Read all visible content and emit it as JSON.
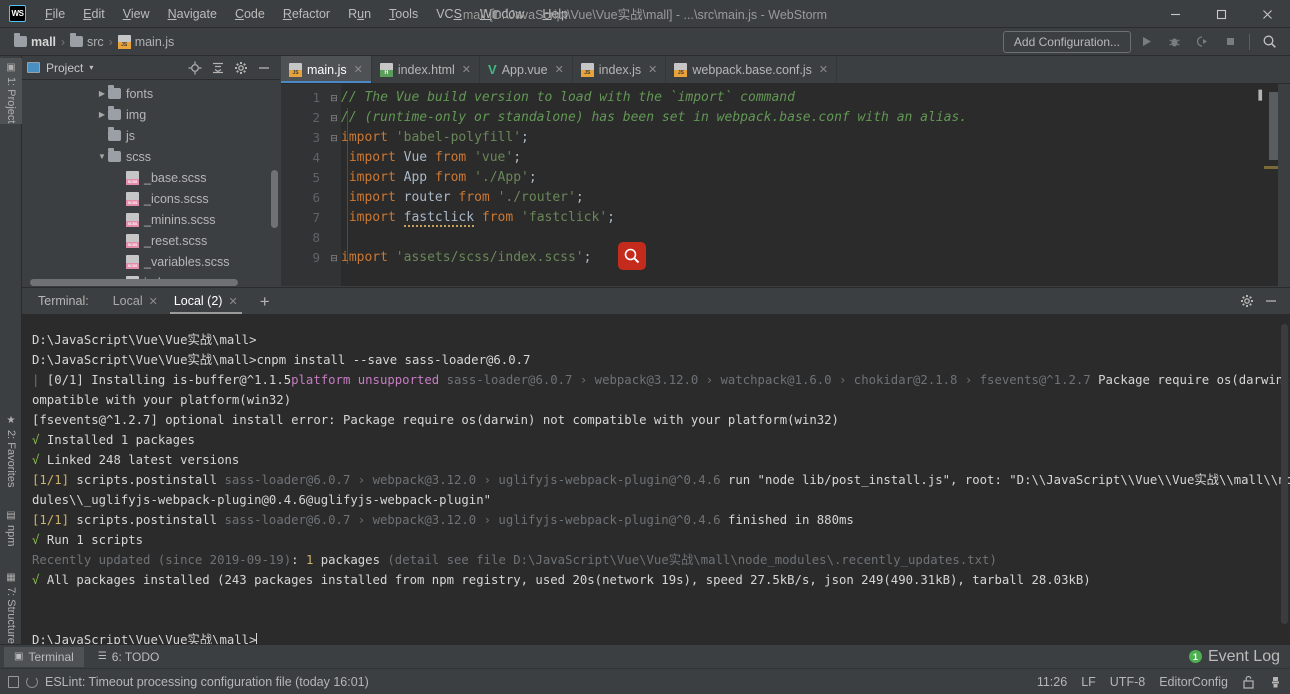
{
  "window": {
    "title": "mall [D:\\JavaScript\\Vue\\Vue实战\\mall] - ...\\src\\main.js - WebStorm",
    "logo": "WS",
    "minimize": "—",
    "maximize": "▢",
    "close": "✕"
  },
  "menubar": {
    "items": [
      "File",
      "Edit",
      "View",
      "Navigate",
      "Code",
      "Refactor",
      "Run",
      "Tools",
      "VCS",
      "Window",
      "Help"
    ]
  },
  "breadcrumb": {
    "items": [
      {
        "label": "mall",
        "icon": "folder-icon"
      },
      {
        "label": "src",
        "icon": "folder-icon"
      },
      {
        "label": "main.js",
        "icon": "js-file-icon"
      }
    ],
    "separator": "›"
  },
  "navbar_right": {
    "add_configuration": "Add Configuration...",
    "icons": [
      "run-icon",
      "debug-icon",
      "run-coverage-icon",
      "stop-icon",
      "search-everywhere-icon"
    ]
  },
  "left_tool_strip": {
    "tabs": [
      {
        "label": "1: Project",
        "icon": "project-icon",
        "active": true
      },
      {
        "label": "2: Favorites",
        "icon": "star-icon",
        "active": false
      },
      {
        "label": "npm",
        "icon": "npm-icon",
        "active": false
      },
      {
        "label": "7: Structure",
        "icon": "structure-icon",
        "active": false
      }
    ]
  },
  "project_panel": {
    "title": "Project",
    "chevron": "▾",
    "tools": [
      "locate-icon",
      "collapse-all-icon",
      "settings-icon",
      "hide-icon"
    ],
    "tree": [
      {
        "label": "fonts",
        "icon": "folder-icon",
        "arrow": "▶",
        "indent": 3,
        "type": "folder"
      },
      {
        "label": "img",
        "icon": "folder-icon",
        "arrow": "▶",
        "indent": 3,
        "type": "folder"
      },
      {
        "label": "js",
        "icon": "folder-icon",
        "arrow": "",
        "indent": 3,
        "type": "folder"
      },
      {
        "label": "scss",
        "icon": "folder-icon",
        "arrow": "▼",
        "indent": 3,
        "type": "folder"
      },
      {
        "label": "_base.scss",
        "icon": "scss-file-icon",
        "arrow": "",
        "indent": 4,
        "type": "file"
      },
      {
        "label": "_icons.scss",
        "icon": "scss-file-icon",
        "arrow": "",
        "indent": 4,
        "type": "file"
      },
      {
        "label": "_minins.scss",
        "icon": "scss-file-icon",
        "arrow": "",
        "indent": 4,
        "type": "file"
      },
      {
        "label": "_reset.scss",
        "icon": "scss-file-icon",
        "arrow": "",
        "indent": 4,
        "type": "file"
      },
      {
        "label": "_variables.scss",
        "icon": "scss-file-icon",
        "arrow": "",
        "indent": 4,
        "type": "file"
      },
      {
        "label": "index.scss",
        "icon": "scss-file-icon",
        "arrow": "",
        "indent": 4,
        "type": "file"
      }
    ]
  },
  "editor": {
    "tabs": [
      {
        "label": "main.js",
        "icon": "js-file-icon",
        "active": true,
        "close": "✕"
      },
      {
        "label": "index.html",
        "icon": "html-file-icon",
        "active": false,
        "close": "✕"
      },
      {
        "label": "App.vue",
        "icon": "vue-file-icon",
        "active": false,
        "close": "✕"
      },
      {
        "label": "index.js",
        "icon": "js-file-icon",
        "active": false,
        "close": "✕"
      },
      {
        "label": "webpack.base.conf.js",
        "icon": "js-file-icon",
        "active": false,
        "close": "✕"
      }
    ],
    "line_numbers": [
      "1",
      "2",
      "3",
      "4",
      "5",
      "6",
      "7",
      "8",
      "9"
    ],
    "code_lines": [
      {
        "n": 1,
        "fold": "⊟",
        "text": "// The Vue build version to load with the `import` command",
        "kind": "comment"
      },
      {
        "n": 2,
        "fold": "⊟",
        "text": "// (runtime-only or standalone) has been set in webpack.base.conf with an alias.",
        "kind": "comment"
      },
      {
        "n": 3,
        "fold": "⊟",
        "kw": "import",
        "str": "'babel-polyfill'",
        "tail": ";",
        "kind": "import-str"
      },
      {
        "n": 4,
        "fold": "",
        "kw": "import",
        "id": "Vue",
        "kw2": "from",
        "str": "'vue'",
        "tail": ";",
        "kind": "import-id"
      },
      {
        "n": 5,
        "fold": "",
        "kw": "import",
        "id": "App",
        "kw2": "from",
        "str": "'./App'",
        "tail": ";",
        "kind": "import-id"
      },
      {
        "n": 6,
        "fold": "",
        "kw": "import",
        "id": "router",
        "kw2": "from",
        "str": "'./router'",
        "tail": ";",
        "kind": "import-id"
      },
      {
        "n": 7,
        "fold": "",
        "kw": "import",
        "id": "fastclick",
        "kw2": "from",
        "str": "'fastclick'",
        "tail": ";",
        "kind": "import-warn"
      },
      {
        "n": 8,
        "fold": "",
        "text": "",
        "kind": "blank"
      },
      {
        "n": 9,
        "fold": "⊟",
        "kw": "import",
        "str": "'assets/scss/index.scss'",
        "tail": ";",
        "kind": "import-str"
      }
    ],
    "cursor_overlay_icon": "search-magnifier-icon"
  },
  "terminal": {
    "label": "Terminal:",
    "tabs": [
      {
        "label": "Local",
        "active": false,
        "close": "✕"
      },
      {
        "label": "Local (2)",
        "active": true,
        "close": "✕"
      }
    ],
    "add": "+",
    "header_icons": [
      "settings-icon",
      "hide-icon"
    ],
    "lines": [
      {
        "segs": [
          {
            "t": "D:\\JavaScript\\Vue\\Vue实战\\mall>",
            "c": "t-white"
          }
        ]
      },
      {
        "segs": [
          {
            "t": "D:\\JavaScript\\Vue\\Vue实战\\mall>cnpm install --save sass-loader@6.0.7",
            "c": "t-white"
          }
        ]
      },
      {
        "segs": [
          {
            "t": "| ",
            "c": "t-dim"
          },
          {
            "t": "[0/1] ",
            "c": "t-white"
          },
          {
            "t": "Installing is-buffer@^1.1.5",
            "c": "t-white"
          },
          {
            "t": "platform unsupported",
            "c": "t-magenta"
          },
          {
            "t": " sass-loader@6.0.7 › webpack@3.12.0 › watchpack@1.6.0 › chokidar@2.1.8 › fsevents@^1.2.7 ",
            "c": "t-dim"
          },
          {
            "t": "Package require os(darwin) not c",
            "c": "t-white"
          }
        ]
      },
      {
        "segs": [
          {
            "t": "ompatible with your platform(win32)",
            "c": "t-white"
          }
        ]
      },
      {
        "segs": [
          {
            "t": "[fsevents@^1.2.7] optional install error: Package require os(darwin) not compatible with your platform(win32)",
            "c": "t-white"
          }
        ]
      },
      {
        "segs": [
          {
            "t": "√ ",
            "c": "t-green"
          },
          {
            "t": "Installed 1 packages",
            "c": "t-white"
          }
        ]
      },
      {
        "segs": [
          {
            "t": "√ ",
            "c": "t-green"
          },
          {
            "t": "Linked 248 latest versions",
            "c": "t-white"
          }
        ]
      },
      {
        "segs": [
          {
            "t": "[1/1] ",
            "c": "t-yellow"
          },
          {
            "t": "scripts.postinstall",
            "c": "t-white"
          },
          {
            "t": " sass-loader@6.0.7 › webpack@3.12.0 › uglifyjs-webpack-plugin@^0.4.6 ",
            "c": "t-dim"
          },
          {
            "t": "run \"node lib/post_install.js\", root: \"D:\\\\JavaScript\\\\Vue\\\\Vue实战\\\\mall\\\\node_mo",
            "c": "t-white"
          }
        ]
      },
      {
        "segs": [
          {
            "t": "dules\\\\_uglifyjs-webpack-plugin@0.4.6@uglifyjs-webpack-plugin\"",
            "c": "t-white"
          }
        ]
      },
      {
        "segs": [
          {
            "t": "[1/1] ",
            "c": "t-yellow"
          },
          {
            "t": "scripts.postinstall",
            "c": "t-white"
          },
          {
            "t": " sass-loader@6.0.7 › webpack@3.12.0 › uglifyjs-webpack-plugin@^0.4.6 ",
            "c": "t-dim"
          },
          {
            "t": "finished in 880ms",
            "c": "t-white"
          }
        ]
      },
      {
        "segs": [
          {
            "t": "√ ",
            "c": "t-green"
          },
          {
            "t": "Run 1 scripts",
            "c": "t-white"
          }
        ]
      },
      {
        "segs": [
          {
            "t": "Recently updated (since 2019-09-19)",
            "c": "t-dim"
          },
          {
            "t": ": ",
            "c": "t-white"
          },
          {
            "t": "1",
            "c": "t-yellow"
          },
          {
            "t": " packages ",
            "c": "t-white"
          },
          {
            "t": "(detail see file D:\\JavaScript\\Vue\\Vue实战\\mall\\node_modules\\.recently_updates.txt)",
            "c": "t-dim"
          }
        ]
      },
      {
        "segs": [
          {
            "t": "√ ",
            "c": "t-green"
          },
          {
            "t": "All packages installed (243 packages installed from npm registry, used 20s(network 19s), speed 27.5kB/s, json 249(490.31kB), tarball 28.03kB)",
            "c": "t-white"
          }
        ]
      },
      {
        "segs": [
          {
            "t": "",
            "c": "t-white"
          }
        ]
      },
      {
        "segs": [
          {
            "t": "",
            "c": "t-white"
          }
        ]
      },
      {
        "segs": [
          {
            "t": "D:\\JavaScript\\Vue\\Vue实战\\mall>",
            "c": "t-white"
          }
        ]
      }
    ]
  },
  "bottom_tools": {
    "tabs": [
      {
        "label": "Terminal",
        "icon": "terminal-icon",
        "active": true
      },
      {
        "label": "6: TODO",
        "icon": "todo-icon",
        "active": false
      }
    ],
    "event_log": "Event Log",
    "event_log_count": "1"
  },
  "statusbar": {
    "message": "ESLint: Timeout processing configuration file (today 16:01)",
    "position": "11:26",
    "line_sep": "LF",
    "encoding": "UTF-8",
    "config": "EditorConfig",
    "icons": [
      "lock-icon",
      "inspection-icon"
    ]
  },
  "colors": {
    "accent": "#4a88c7",
    "panel_bg": "#3c3f41",
    "editor_bg": "#2b2b2b",
    "keyword": "#cc7832",
    "string": "#6a8759",
    "comment": "#629755",
    "cursor_red": "#c42b1c",
    "vue_green": "#42b883"
  }
}
